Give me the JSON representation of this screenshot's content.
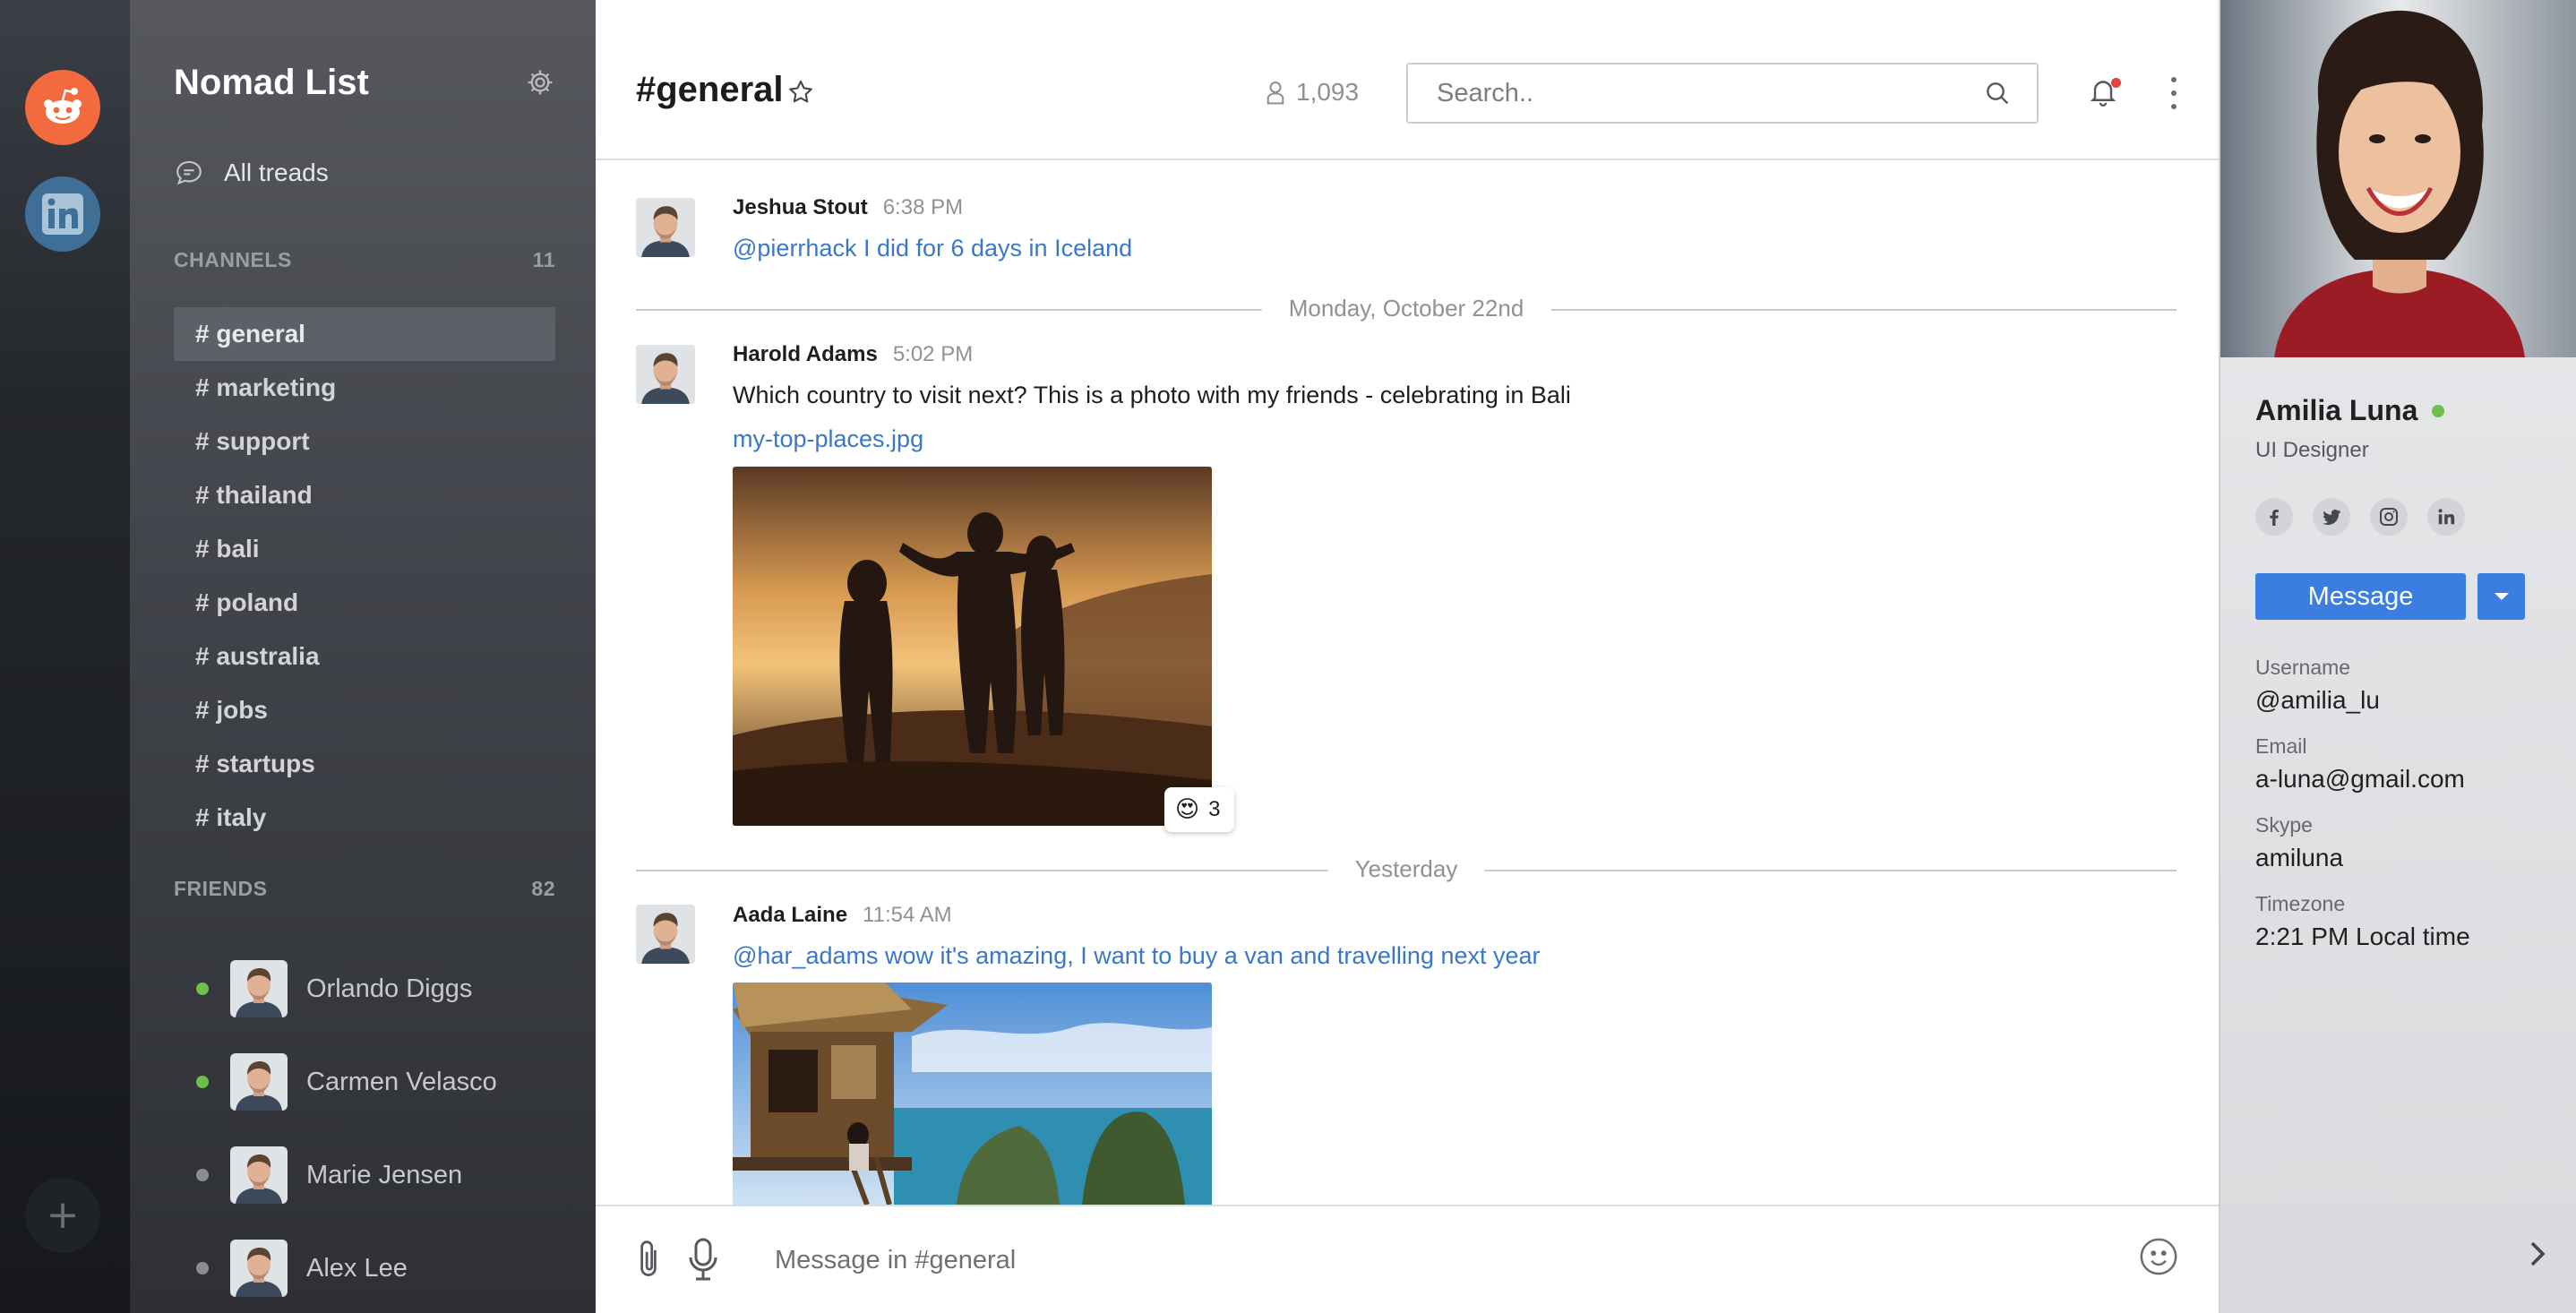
{
  "workspaces": [
    {
      "name": "reddit-icon"
    },
    {
      "name": "linkedin-icon"
    }
  ],
  "sidebar": {
    "team_name": "Nomad List",
    "threads_label": "All treads",
    "channels_heading": "CHANNELS",
    "channels_count": "11",
    "channels": [
      {
        "label": "# general",
        "active": true
      },
      {
        "label": "# marketing"
      },
      {
        "label": "# support"
      },
      {
        "label": "# thailand"
      },
      {
        "label": "# bali"
      },
      {
        "label": "# poland"
      },
      {
        "label": "# australia"
      },
      {
        "label": "# jobs"
      },
      {
        "label": "# startups"
      },
      {
        "label": "# italy"
      }
    ],
    "friends_heading": "FRIENDS",
    "friends_count": "82",
    "friends": [
      {
        "name": "Orlando Diggs",
        "status": "online"
      },
      {
        "name": "Carmen Velasco",
        "status": "online"
      },
      {
        "name": "Marie Jensen",
        "status": "offline"
      },
      {
        "name": "Alex Lee",
        "status": "offline"
      }
    ]
  },
  "header": {
    "channel_title": "#general",
    "member_count": "1,093",
    "search_placeholder": "Search.."
  },
  "messages": [
    {
      "author": "Jeshua Stout",
      "time": "6:38 PM",
      "text": "@pierrhack I did for 6 days in Iceland"
    },
    {
      "author": "Harold Adams",
      "time": "5:02 PM",
      "text": "Which country to visit next? This is a photo with my friends - celebrating in Bali",
      "file": "my-top-places.jpg",
      "reaction_emoji": "😍",
      "reaction_count": "3"
    },
    {
      "author": "Aada Laine",
      "time": "11:54 AM",
      "text": "@har_adams wow it's amazing, I want to buy a van and travelling next year"
    }
  ],
  "dividers": [
    "Monday, October 22nd",
    "Yesterday"
  ],
  "composer": {
    "placeholder": "Message in #general"
  },
  "profile": {
    "name": "Amilia Luna",
    "role": "UI Designer",
    "message_button": "Message",
    "username_label": "Username",
    "username": "@amilia_lu",
    "email_label": "Email",
    "email": "a-luna@gmail.com",
    "skype_label": "Skype",
    "skype": "amiluna",
    "timezone_label": "Timezone",
    "timezone": "2:21 PM Local time"
  },
  "colors": {
    "accent": "#3b7de0",
    "link": "#3a77c9",
    "online": "#6cc04a",
    "notification": "#e8423c"
  }
}
